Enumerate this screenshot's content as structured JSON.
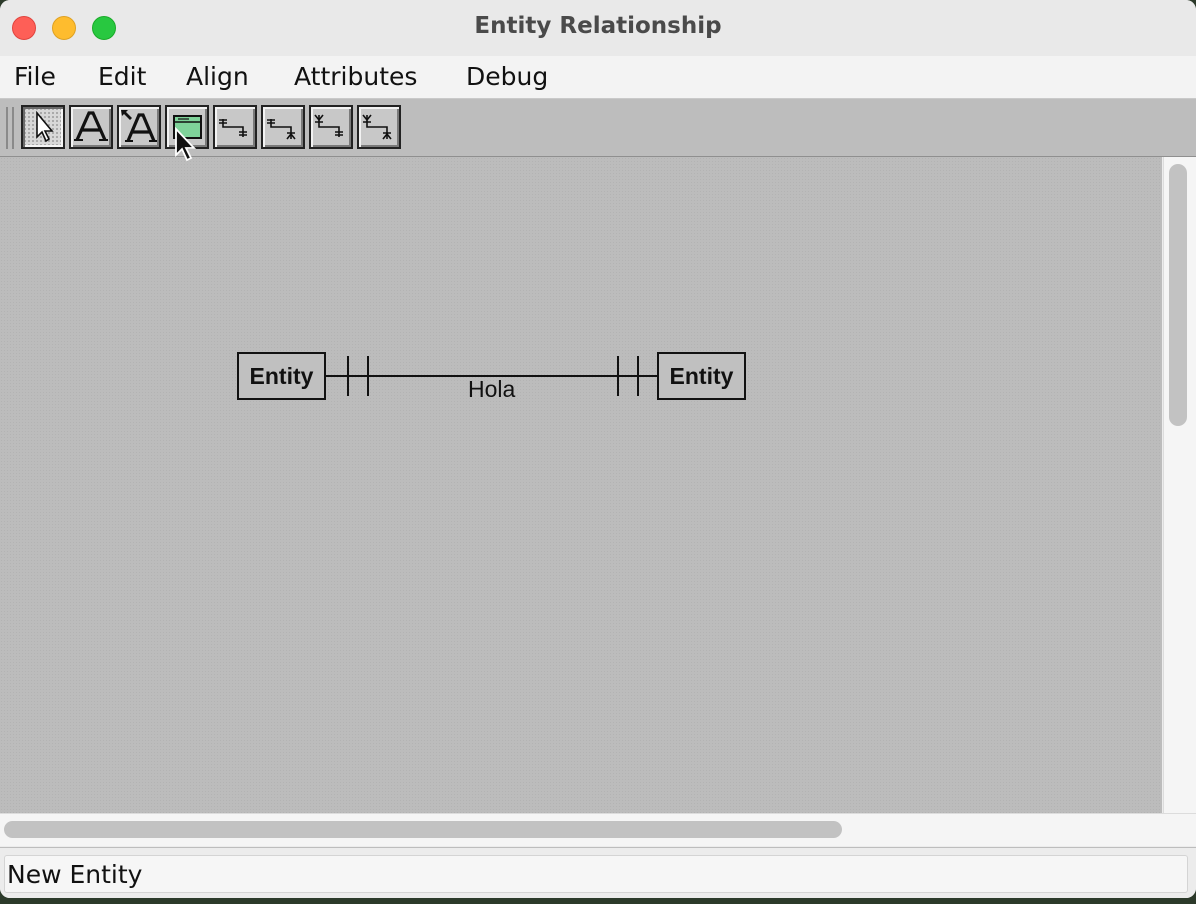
{
  "window": {
    "title": "Entity Relationship"
  },
  "menu": [
    "File",
    "Edit",
    "Align",
    "Attributes",
    "Debug"
  ],
  "toolbar": {
    "tools": [
      {
        "icon": "select-arrow-icon"
      },
      {
        "icon": "text-icon"
      },
      {
        "icon": "text-with-arrow-icon"
      },
      {
        "icon": "new-entity-icon"
      },
      {
        "icon": "one-to-one-relation-icon"
      },
      {
        "icon": "one-to-many-relation-icon"
      },
      {
        "icon": "many-to-one-relation-icon"
      },
      {
        "icon": "many-to-many-relation-icon"
      }
    ],
    "active_tool": "select-arrow-icon",
    "colors": {
      "entity_tool_fill": "#7fd39a"
    }
  },
  "diagram": {
    "entities": [
      "Entity",
      "Entity"
    ],
    "relationship": {
      "label": "Hola",
      "cardinality_left": "one-and-only-one",
      "cardinality_right": "one-and-only-one"
    }
  },
  "status": {
    "text": "New Entity"
  },
  "colors": {
    "canvas": "#bcbcbc",
    "close": "#fe5f57",
    "minimize": "#febc2e",
    "maximize": "#28c840"
  }
}
